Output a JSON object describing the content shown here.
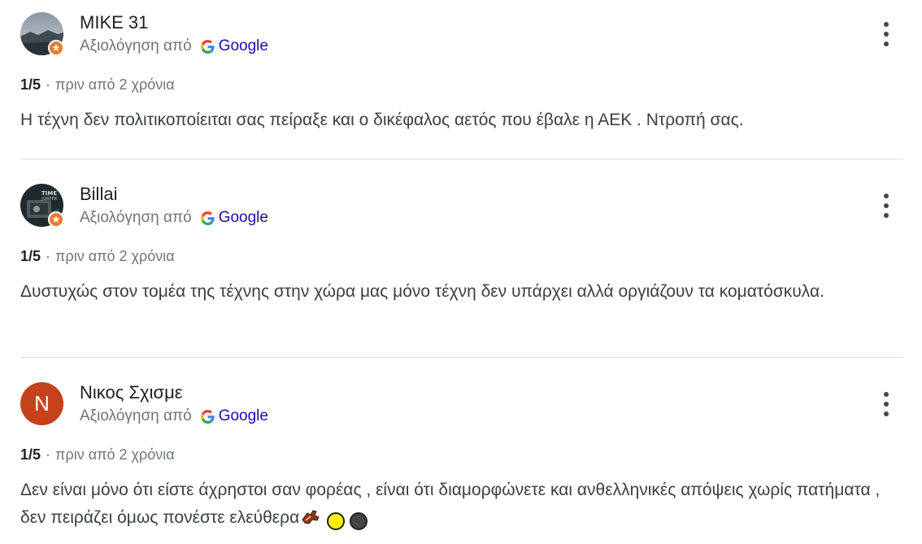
{
  "reviews": [
    {
      "author": "MIKE 31",
      "avatar_type": "photo-landscape",
      "source_prefix": "Αξιολόγηση από",
      "source_name": "Google",
      "rating": "1/5",
      "separator": "·",
      "time": "πριν από 2 χρόνια",
      "text": "Η τέχνη δεν πολιτικοποίειται σας πείραξε και ο δικέφαλος αετός που έβαλε η ΑΕΚ . Ντροπή σας.",
      "local_guide_badge": true
    },
    {
      "author": "Billai",
      "avatar_type": "photo-dark-poster",
      "source_prefix": "Αξιολόγηση από",
      "source_name": "Google",
      "rating": "1/5",
      "separator": "·",
      "time": "πριν από 2 χρόνια",
      "text": "Δυστυχώς στον τομέα της τέχνης στην χώρα μας μόνο τέχνη δεν υπάρχει αλλά οργιάζουν τα κοματόσκυλα.",
      "local_guide_badge": true
    },
    {
      "author": "Νικος Σχισμε",
      "avatar_type": "letter",
      "avatar_letter": "N",
      "source_prefix": "Αξιολόγηση από",
      "source_name": "Google",
      "rating": "1/5",
      "separator": "·",
      "time": "πριν από 2 χρόνια",
      "text": "Δεν είναι μόνο ότι είστε άχρηστοι σαν φορέας , είναι ότι διαμορφώνετε και ανθελληνικές απόψεις χωρίς πατήματα , δεν πειράζει όμως πονέστε ελεύθερα",
      "emojis": [
        "running-shoe-emoji",
        "yellow-circle-emoji",
        "black-circle-emoji"
      ],
      "local_guide_badge": false
    }
  ],
  "colors": {
    "link": "#1a0dab",
    "muted": "#70757a",
    "badge": "#ea7a2f",
    "letter_avatar": "#c5421c"
  },
  "icons": {
    "more": "more-vert-icon",
    "google": "google-g-icon",
    "badge": "local-guide-badge-icon"
  }
}
